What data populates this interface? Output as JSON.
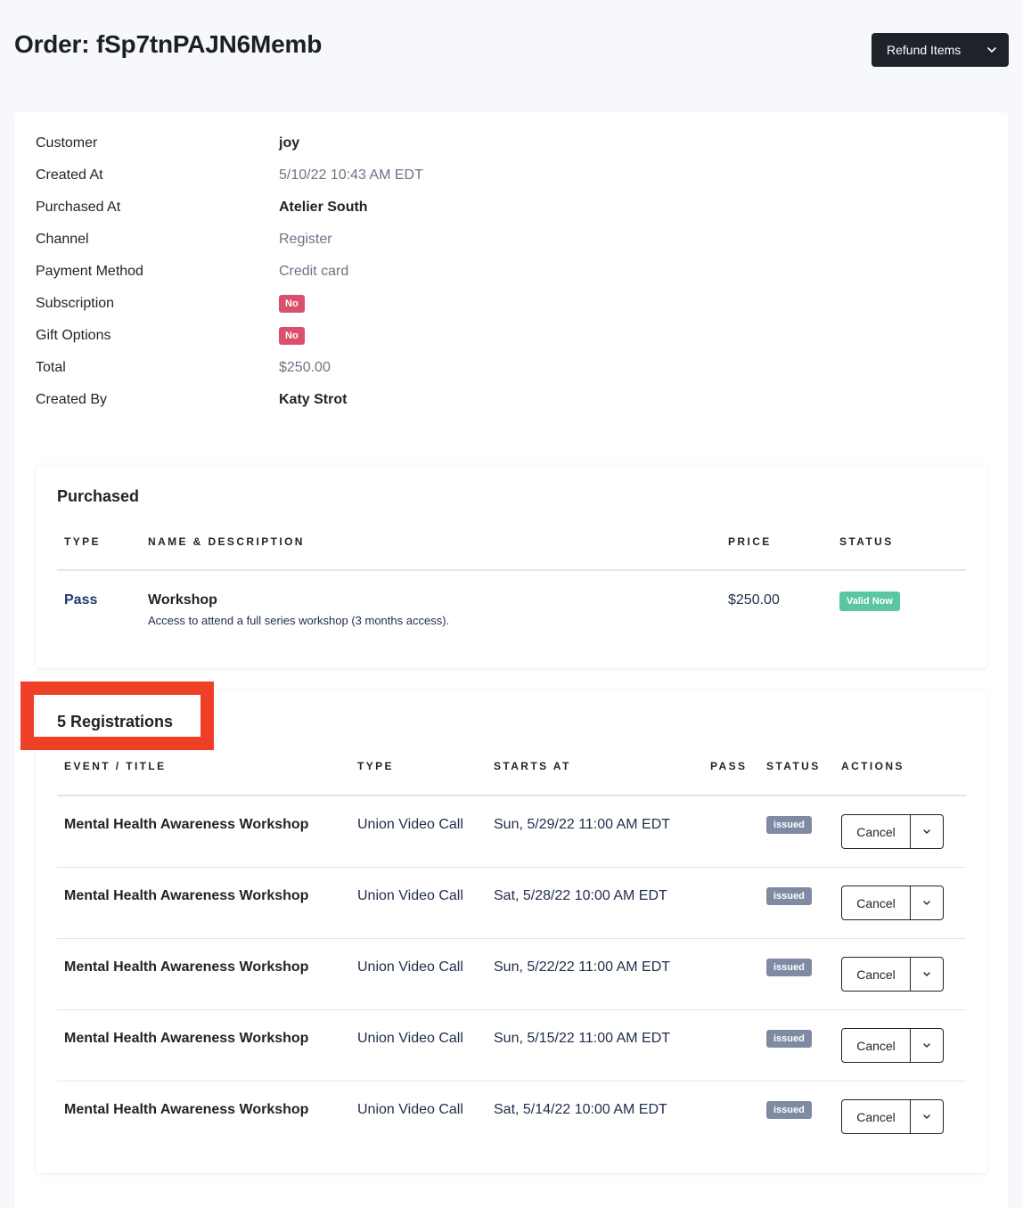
{
  "header": {
    "title": "Order: fSp7tnPAJN6Memb",
    "refund_label": "Refund Items"
  },
  "details": [
    {
      "key": "Customer",
      "value": "joy",
      "style": "strong"
    },
    {
      "key": "Created At",
      "value": "5/10/22 10:43 AM EDT",
      "style": "muted"
    },
    {
      "key": "Purchased At",
      "value": "Atelier South",
      "style": "strong"
    },
    {
      "key": "Channel",
      "value": "Register",
      "style": "muted"
    },
    {
      "key": "Payment Method",
      "value": "Credit card",
      "style": "muted"
    },
    {
      "key": "Subscription",
      "value": "No",
      "style": "badge"
    },
    {
      "key": "Gift Options",
      "value": "No",
      "style": "badge"
    },
    {
      "key": "Total",
      "value": "$250.00",
      "style": "muted"
    },
    {
      "key": "Created By",
      "value": "Katy Strot",
      "style": "strong"
    }
  ],
  "purchased": {
    "title": "Purchased",
    "headers": {
      "type": "TYPE",
      "name": "NAME & DESCRIPTION",
      "price": "PRICE",
      "status": "STATUS"
    },
    "item": {
      "type": "Pass",
      "name": "Workshop",
      "description": "Access to attend a full series workshop (3 months access).",
      "price": "$250.00",
      "status": "Valid Now"
    }
  },
  "registrations": {
    "title": "5 Registrations",
    "headers": {
      "event": "EVENT / TITLE",
      "type": "TYPE",
      "starts": "STARTS AT",
      "pass": "PASS",
      "status": "STATUS",
      "actions": "ACTIONS"
    },
    "rows": [
      {
        "title": "Mental Health Awareness Workshop",
        "type": "Union Video Call",
        "starts": "Sun, 5/29/22 11:00 AM EDT",
        "status": "issued",
        "action": "Cancel"
      },
      {
        "title": "Mental Health Awareness Workshop",
        "type": "Union Video Call",
        "starts": "Sat, 5/28/22 10:00 AM EDT",
        "status": "issued",
        "action": "Cancel"
      },
      {
        "title": "Mental Health Awareness Workshop",
        "type": "Union Video Call",
        "starts": "Sun, 5/22/22 11:00 AM EDT",
        "status": "issued",
        "action": "Cancel"
      },
      {
        "title": "Mental Health Awareness Workshop",
        "type": "Union Video Call",
        "starts": "Sun, 5/15/22 11:00 AM EDT",
        "status": "issued",
        "action": "Cancel"
      },
      {
        "title": "Mental Health Awareness Workshop",
        "type": "Union Video Call",
        "starts": "Sat, 5/14/22 10:00 AM EDT",
        "status": "issued",
        "action": "Cancel"
      }
    ]
  },
  "colors": {
    "badge_no": "#d9506b",
    "badge_valid": "#5bc7a2",
    "badge_issued": "#7e8ba3",
    "highlight": "#ee4027",
    "dark_button": "#1e2229"
  }
}
